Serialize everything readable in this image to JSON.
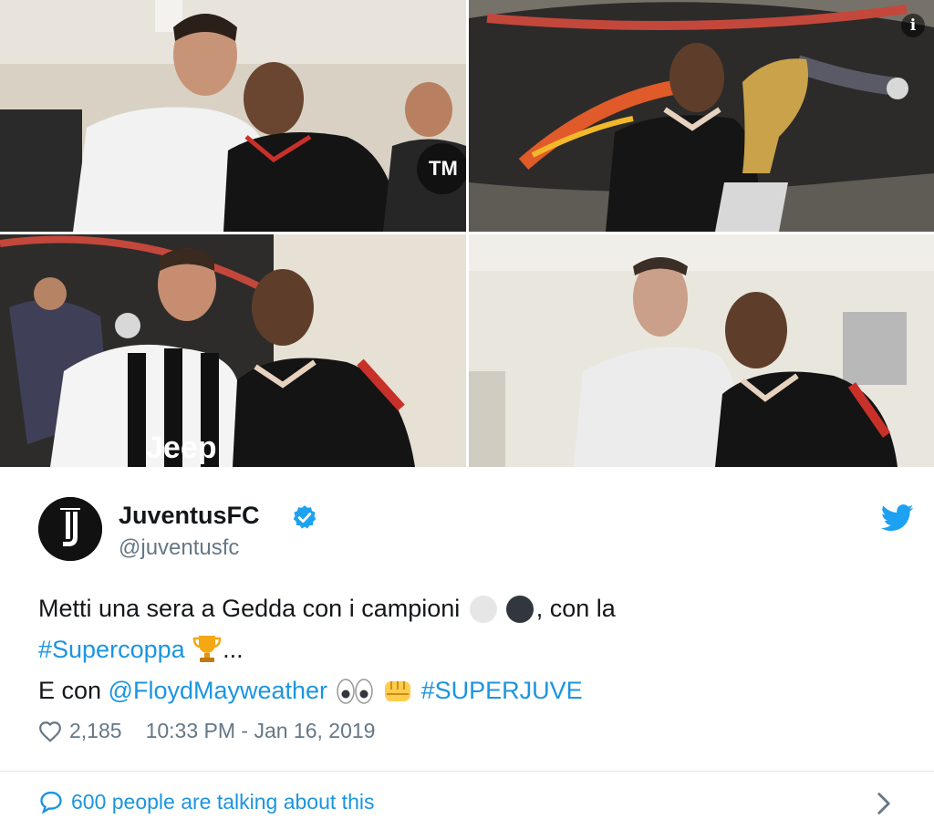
{
  "photos": [
    {
      "name": "photo-ronaldo-mayweather"
    },
    {
      "name": "photo-mayweather-trophy"
    },
    {
      "name": "photo-pjanic-mayweather"
    },
    {
      "name": "photo-chiellini-mayweather"
    }
  ],
  "tweet": {
    "author_name": "JuventusFC",
    "author_handle": "@juventusfc",
    "text_line1_a": "Metti una sera a Gedda con i campioni ",
    "text_line1_b": ", con la",
    "hashtag_supercoppa": "#Supercoppa",
    "ellipsis": "...",
    "text_line3_a": "E con ",
    "mention": "@FloydMayweather",
    "hashtag_superjuve": "#SUPERJUVE",
    "likes": "2,185",
    "timestamp": "10:33 PM - Jan 16, 2019",
    "talking": "600 people are talking about this"
  },
  "icons": {
    "info": "info-icon",
    "verified": "verified-badge-icon",
    "twitter": "twitter-bird-icon",
    "heart": "heart-icon",
    "reply": "speech-bubble-icon",
    "chevron": "chevron-right-icon",
    "emoji_white_circle": "white-circle-emoji",
    "emoji_black_circle": "black-circle-emoji",
    "emoji_trophy": "trophy-emoji",
    "emoji_eyes": "eyes-emoji",
    "emoji_fist": "oncoming-fist-emoji"
  },
  "colors": {
    "link": "#1b95e0",
    "text": "#14171a",
    "muted": "#657786",
    "verified": "#1da1f2"
  }
}
